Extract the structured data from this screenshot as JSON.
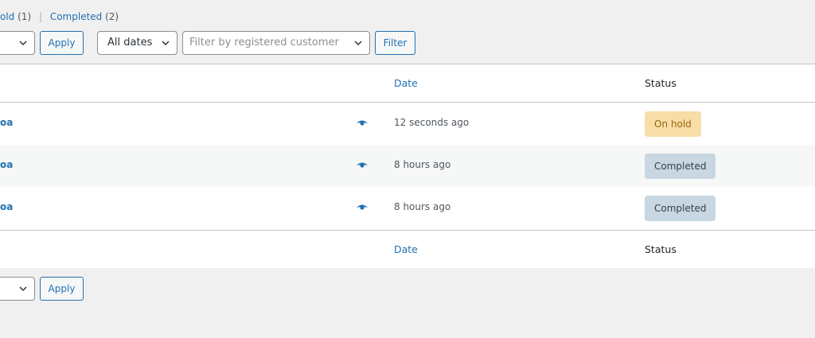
{
  "status_links": {
    "onhold_label": "old",
    "onhold_count": "(1)",
    "separator": "|",
    "completed_label": "Completed",
    "completed_count": "(2)"
  },
  "top_filters": {
    "bulk_action_value": "",
    "apply_label": "Apply",
    "dates_value": "All dates",
    "customer_placeholder": "Filter by registered customer",
    "filter_label": "Filter"
  },
  "table": {
    "headers": {
      "date": "Date",
      "status": "Status"
    },
    "rows": [
      {
        "name": "oa",
        "preview_icon": "eye-icon",
        "date": "12 seconds ago",
        "status": "On hold",
        "status_key": "onhold"
      },
      {
        "name": "oa",
        "preview_icon": "eye-icon",
        "date": "8 hours ago",
        "status": "Completed",
        "status_key": "completed"
      },
      {
        "name": "oa",
        "preview_icon": "eye-icon",
        "date": "8 hours ago",
        "status": "Completed",
        "status_key": "completed"
      }
    ],
    "footer": {
      "date": "Date",
      "status": "Status"
    }
  },
  "bottom_filters": {
    "bulk_action_value": "",
    "apply_label": "Apply"
  },
  "colors": {
    "link": "#2271b1",
    "onhold_bg": "#f8dda7",
    "onhold_text": "#94660c",
    "completed_bg": "#c8d7e1",
    "completed_text": "#2e4453"
  }
}
